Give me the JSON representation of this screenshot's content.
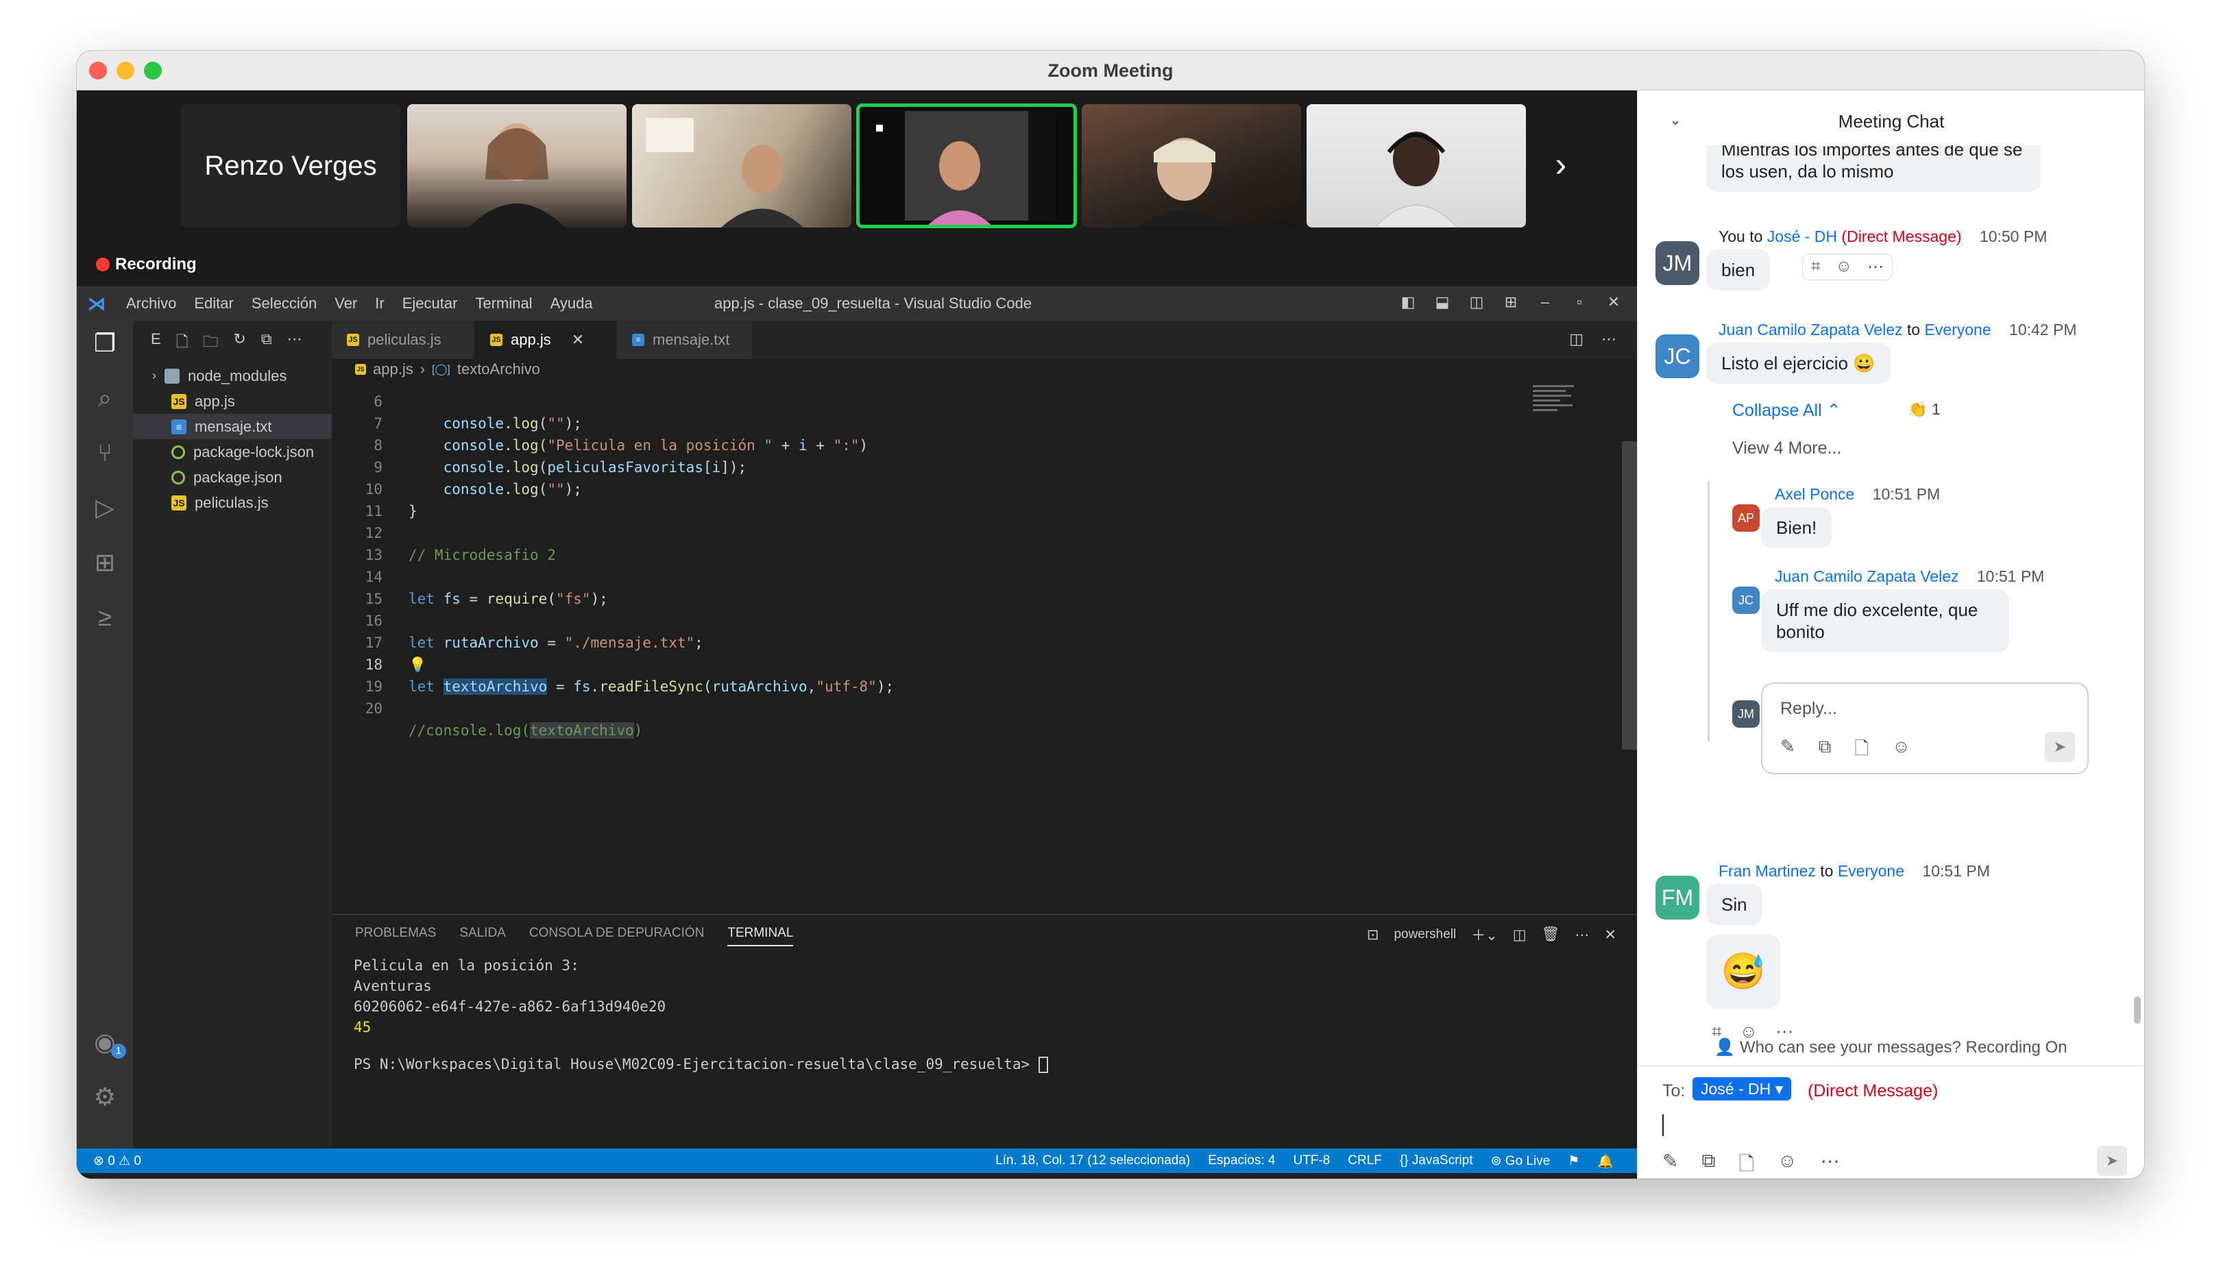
{
  "window": {
    "title": "Zoom Meeting"
  },
  "meeting": {
    "participant_name": "Renzo Verges",
    "recording_label": "Recording"
  },
  "vscode": {
    "menu": [
      "Archivo",
      "Editar",
      "Selección",
      "Ver",
      "Ir",
      "Ejecutar",
      "Terminal",
      "Ayuda"
    ],
    "window_title": "app.js - clase_09_resuelta - Visual Studio Code",
    "explorer_initial": "E",
    "files": [
      {
        "name": "node_modules",
        "type": "folder"
      },
      {
        "name": "app.js",
        "type": "js"
      },
      {
        "name": "mensaje.txt",
        "type": "txt"
      },
      {
        "name": "package-lock.json",
        "type": "json"
      },
      {
        "name": "package.json",
        "type": "json"
      },
      {
        "name": "peliculas.js",
        "type": "js"
      }
    ],
    "tabs": [
      {
        "label": "peliculas.js",
        "type": "js"
      },
      {
        "label": "app.js",
        "type": "js"
      },
      {
        "label": "mensaje.txt",
        "type": "txt"
      }
    ],
    "breadcrumb": {
      "file": "app.js",
      "symbol": "textoArchivo"
    },
    "code_lines": [
      {
        "n": "6",
        "text": "    console.log(\"\");"
      },
      {
        "n": "7",
        "text": "    console.log(\"Pelicula en la posición \" + i + \":\")"
      },
      {
        "n": "8",
        "text": "    console.log(peliculasFavoritas[i]);"
      },
      {
        "n": "9",
        "text": "    console.log(\"\");"
      },
      {
        "n": "10",
        "text": "}"
      },
      {
        "n": "11",
        "text": ""
      },
      {
        "n": "12",
        "text": "// Microdesafio 2"
      },
      {
        "n": "13",
        "text": ""
      },
      {
        "n": "14",
        "text": "let fs = require(\"fs\");"
      },
      {
        "n": "15",
        "text": ""
      },
      {
        "n": "16",
        "text": "let rutaArchivo = \"./mensaje.txt\";"
      },
      {
        "n": "17",
        "text": ""
      },
      {
        "n": "18",
        "text": "let textoArchivo = fs.readFileSync(rutaArchivo,\"utf-8\");"
      },
      {
        "n": "19",
        "text": ""
      },
      {
        "n": "20",
        "text": "//console.log(textoArchivo)"
      }
    ],
    "panel_tabs": [
      "PROBLEMAS",
      "SALIDA",
      "CONSOLA DE DEPURACIÓN",
      "TERMINAL"
    ],
    "terminal_shell": "powershell",
    "terminal_lines": [
      "Pelicula en la posición 3:",
      "Aventuras",
      "60206062-e64f-427e-a862-6af13d940e20",
      "45",
      "",
      "PS N:\\Workspaces\\Digital House\\M02C09-Ejercitacion-resuelta\\clase_09_resuelta> "
    ],
    "status_left": "⊗ 0 ⚠ 0",
    "status_right": [
      "Lín. 18, Col. 17 (12 seleccionada)",
      "Espacios: 4",
      "UTF-8",
      "CRLF",
      "{} JavaScript",
      "Go Live"
    ],
    "account_badge": "1"
  },
  "chat": {
    "title": "Meeting Chat",
    "partial_message": "Mientras los importes antes de que se los usen, da lo mismo",
    "msg1": {
      "avatar": "JM",
      "from": "You",
      "to_word": "to",
      "to": "José - DH",
      "dm": "(Direct Message)",
      "time": "10:50 PM",
      "text": "bien"
    },
    "msg2": {
      "avatar": "JC",
      "from": "Juan Camilo Zapata Velez",
      "to_word": "to",
      "to": "Everyone",
      "time": "10:42 PM",
      "text": "Listo el ejercicio 😀"
    },
    "collapse_all": "Collapse All",
    "reaction": "👏 1",
    "view_more": "View 4 More...",
    "reply1": {
      "avatar": "AP",
      "from": "Axel Ponce",
      "time": "10:51 PM",
      "text": "Bien!"
    },
    "reply2": {
      "avatar": "JC",
      "from": "Juan Camilo Zapata Velez",
      "time": "10:51 PM",
      "text": "Uff me dio excelente, que bonito"
    },
    "reply_avatar": "JM",
    "reply_placeholder": "Reply...",
    "msg3": {
      "avatar": "FM",
      "from": "Fran Martinez",
      "to_word": "to",
      "to": "Everyone",
      "time": "10:51 PM",
      "text": "Sin",
      "emoji": "😅"
    },
    "who_can_see": "Who can see your messages? Recording On",
    "compose": {
      "to_label": "To:",
      "recipient": "José - DH",
      "dm": "(Direct Message)"
    },
    "colors": {
      "accent": "#0e71eb",
      "dm": "#d0021b",
      "avatar_jm": "#4a5a6a",
      "avatar_jc": "#3f86c7",
      "avatar_ap": "#c8492f",
      "avatar_fm": "#3fb08c"
    }
  }
}
